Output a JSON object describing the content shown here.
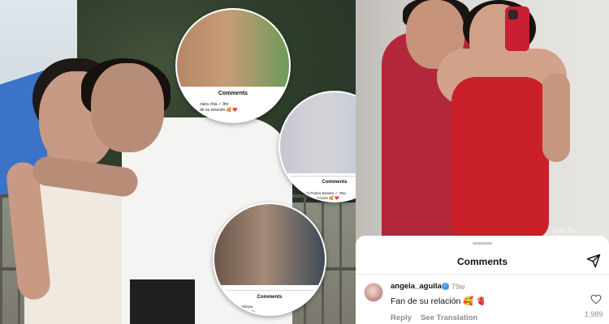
{
  "insets": {
    "shakira": {
      "sheet_title": "Comments",
      "user": "clara chia ✓ 8m",
      "comment": "de su relación 🥰 ❤️"
    },
    "diana": {
      "sheet_title": "Comments",
      "user": "Camila Parker Bowles ✓ 29w",
      "comment": "Fan de su relación 🥰 ❤️"
    },
    "couple": {
      "sheet_title": "Comments",
      "user": "paisleyw",
      "comment": "Fan de su"
    }
  },
  "photo": {
    "watermark": "Ivan Blu"
  },
  "comments_sheet": {
    "title": "Comments",
    "share_icon": "send-icon",
    "comment": {
      "username": "angela_aguilar_",
      "verified": "✓",
      "time": "79w",
      "text": "Fan de su relación 🥰 🫀",
      "reply_label": "Reply",
      "translate_label": "See Translation",
      "like_count": "1,989",
      "like_icon": "heart-outline-icon"
    }
  }
}
